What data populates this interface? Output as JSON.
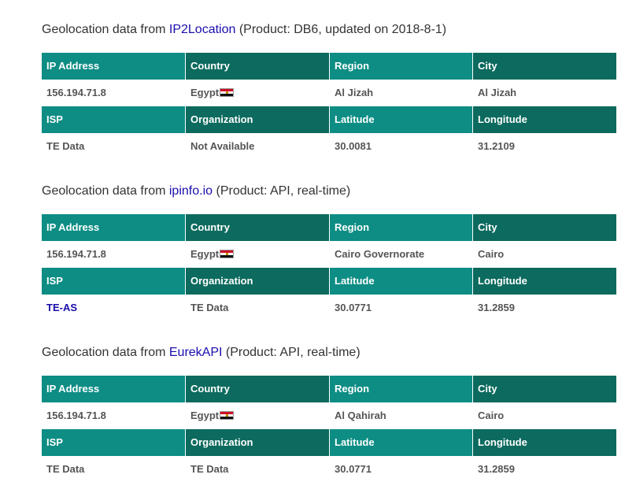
{
  "sections": [
    {
      "heading_prefix": "Geolocation data from",
      "provider": "IP2Location",
      "heading_suffix": "(Product: DB6, updated on 2018-8-1)",
      "headers_top": [
        "IP Address",
        "Country",
        "Region",
        "City"
      ],
      "values_top": [
        "156.194.71.8",
        "Egypt",
        "Al Jizah",
        "Al Jizah"
      ],
      "headers_bottom": [
        "ISP",
        "Organization",
        "Latitude",
        "Longitude"
      ],
      "values_bottom": [
        "TE Data",
        "Not Available",
        "30.0081",
        "31.2109"
      ]
    },
    {
      "heading_prefix": "Geolocation data from",
      "provider": "ipinfo.io",
      "heading_suffix": "(Product: API, real-time)",
      "headers_top": [
        "IP Address",
        "Country",
        "Region",
        "City"
      ],
      "values_top": [
        "156.194.71.8",
        "Egypt",
        "Cairo Governorate",
        "Cairo"
      ],
      "headers_bottom": [
        "ISP",
        "Organization",
        "Latitude",
        "Longitude"
      ],
      "values_bottom": [
        "TE-AS",
        "TE Data",
        "30.0771",
        "31.2859"
      ]
    },
    {
      "heading_prefix": "Geolocation data from",
      "provider": "EurekAPI",
      "heading_suffix": "(Product: API, real-time)",
      "headers_top": [
        "IP Address",
        "Country",
        "Region",
        "City"
      ],
      "values_top": [
        "156.194.71.8",
        "Egypt",
        "Al Qahirah",
        "Cairo"
      ],
      "headers_bottom": [
        "ISP",
        "Organization",
        "Latitude",
        "Longitude"
      ],
      "values_bottom": [
        "TE Data",
        "TE Data",
        "30.0771",
        "31.2859"
      ]
    }
  ],
  "colors": {
    "header_light": "#0d8d84",
    "header_dark": "#0c6a5e",
    "link": "#1a0dab",
    "value_text": "#555555"
  },
  "icons": {
    "country_flag": "egypt-flag-icon"
  }
}
